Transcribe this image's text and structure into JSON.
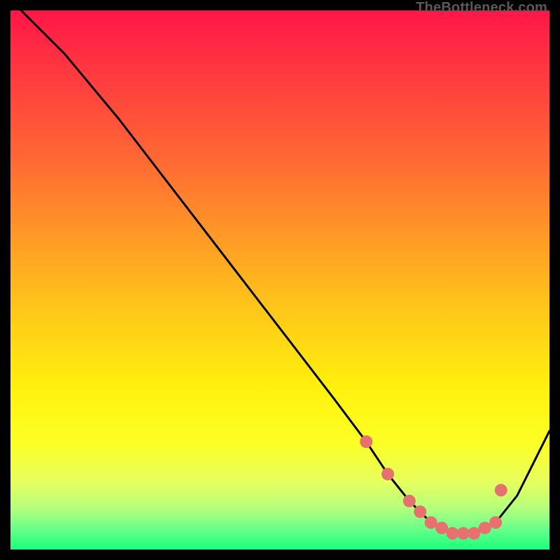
{
  "watermark": "TheBottleneck.com",
  "chart_data": {
    "type": "line",
    "title": "",
    "xlabel": "",
    "ylabel": "",
    "xlim": [
      0,
      100
    ],
    "ylim": [
      0,
      100
    ],
    "x": [
      0,
      4,
      10,
      20,
      30,
      40,
      50,
      60,
      66,
      70,
      74,
      78,
      82,
      86,
      90,
      94,
      100
    ],
    "values": [
      102,
      98,
      92,
      80,
      67,
      54,
      41,
      28,
      20,
      14,
      9,
      5,
      3,
      3,
      5,
      10,
      22
    ],
    "dots": {
      "x": [
        66,
        70,
        74,
        76,
        78,
        80,
        82,
        84,
        86,
        88,
        90,
        91
      ],
      "values": [
        20,
        14,
        9,
        7,
        5,
        4,
        3,
        3,
        3,
        4,
        5,
        11
      ]
    },
    "curve_color": "#000000",
    "dot_color": "#E6716E",
    "dot_radius_px": 9
  }
}
